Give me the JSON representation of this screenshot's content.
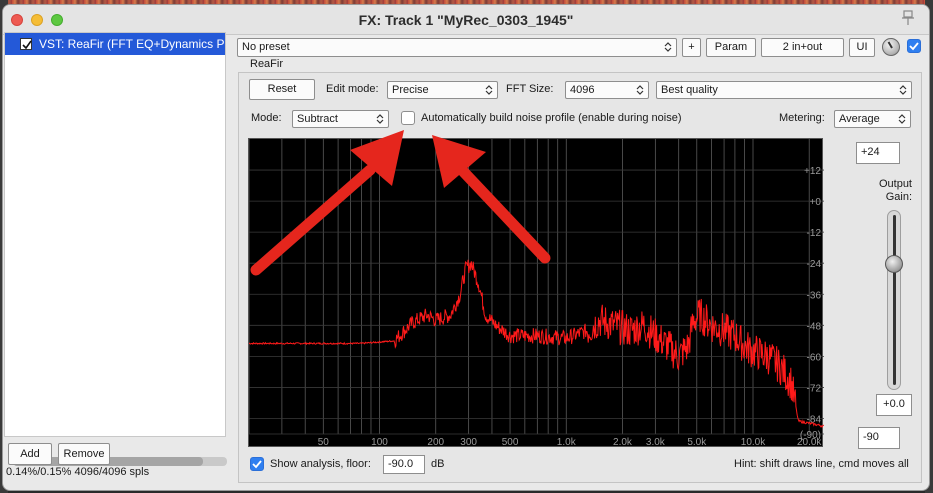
{
  "window": {
    "title": "FX: Track 1 \"MyRec_0303_1945\""
  },
  "fx_chain": {
    "items": [
      {
        "label": "VST: ReaFir (FFT EQ+Dynamics Processor)",
        "enabled": true
      }
    ],
    "add_label": "Add",
    "remove_label": "Remove",
    "status": "0.14%/0.15% 4096/4096 spls"
  },
  "toolbar": {
    "preset": "No preset",
    "plus_label": "+",
    "param_label": "Param",
    "io_label": "2 in+out",
    "ui_label": "UI"
  },
  "plugin": {
    "tab_label": "ReaFir",
    "reset_label": "Reset",
    "edit_mode_label": "Edit mode:",
    "edit_mode_value": "Precise",
    "fft_size_label": "FFT Size:",
    "fft_size_value": "4096",
    "quality_value": "Best quality",
    "mode_label": "Mode:",
    "mode_value": "Subtract",
    "auto_build_label": "Automatically build noise profile (enable during noise)",
    "metering_label": "Metering:",
    "metering_value": "Average",
    "top_value": "+24",
    "bottom_value": "-90",
    "output_gain_label": "Output\nGain:",
    "output_gain_value": "+0.0",
    "show_analysis_label": "Show analysis, floor:",
    "floor_value": "-90.0",
    "floor_unit": "dB",
    "hint": "Hint: shift draws line, cmd moves all"
  },
  "chart_data": {
    "type": "line",
    "x_ticks": [
      "50",
      "100",
      "200",
      "300",
      "500",
      "1.0k",
      "2.0k",
      "3.0k",
      "5.0k",
      "10.0k",
      "20.0k"
    ],
    "y_ticks": [
      "+12",
      "+0",
      "-12",
      "-24",
      "-36",
      "-48",
      "-60",
      "-72",
      "-84",
      "(-90)"
    ],
    "line_color": "#ff1a1a",
    "accent_color": "#e5261d"
  }
}
